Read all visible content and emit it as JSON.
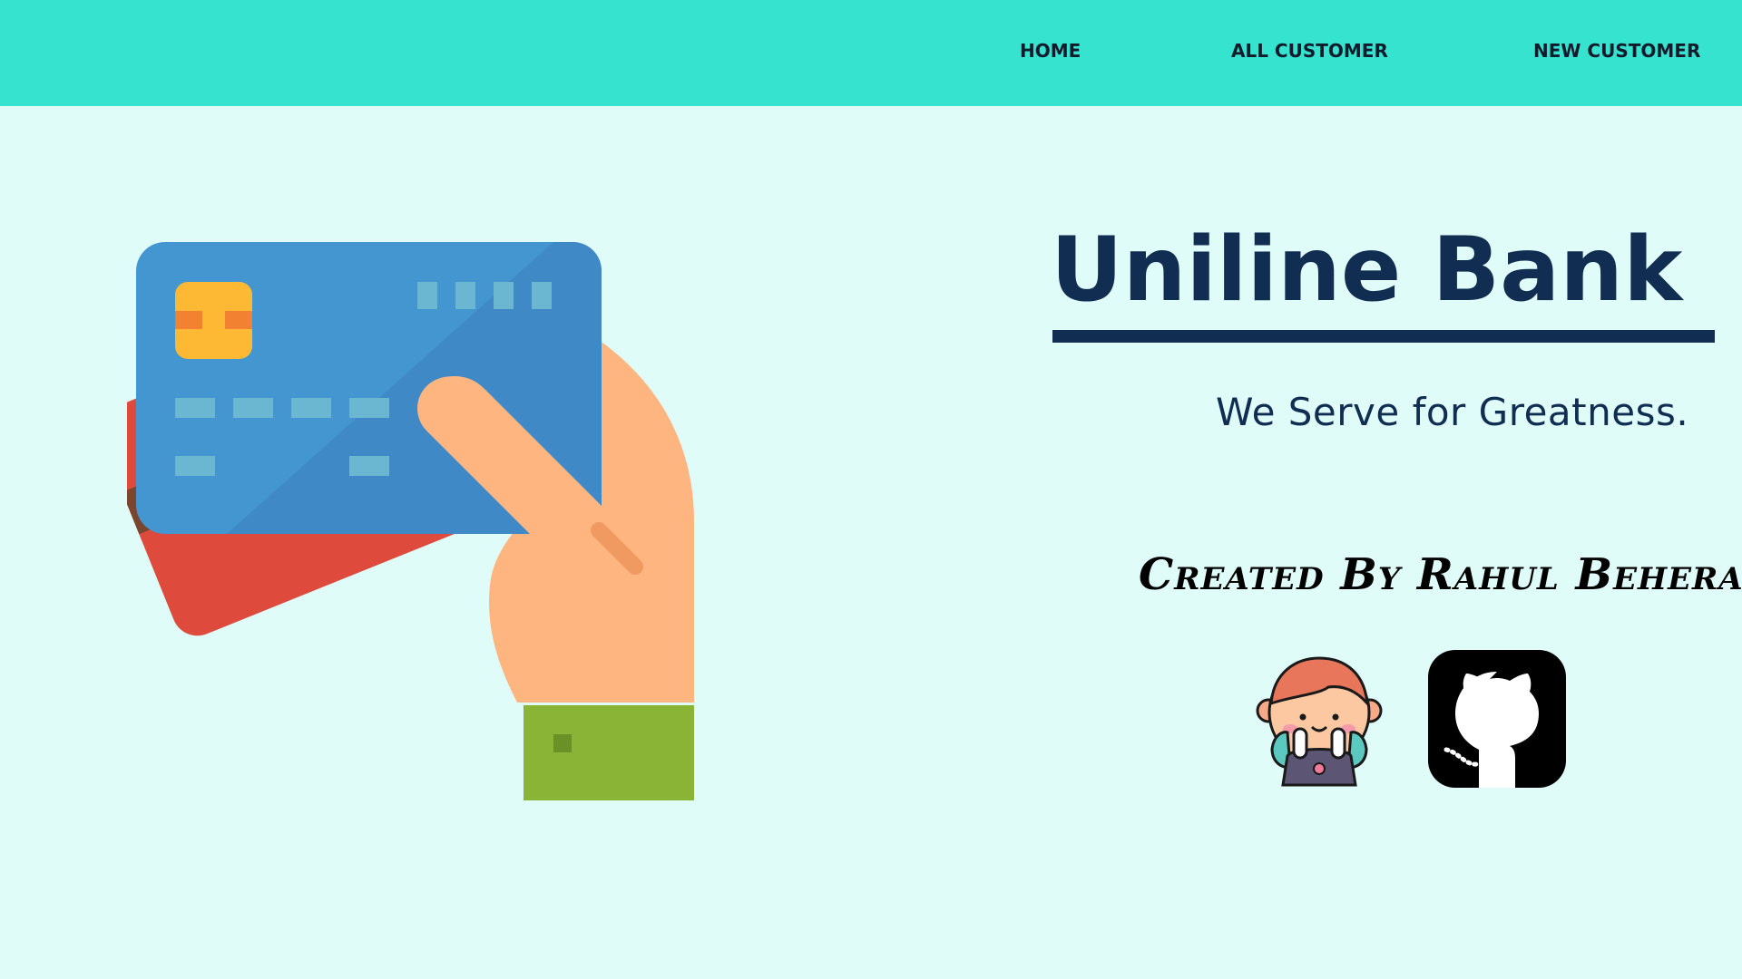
{
  "nav": {
    "home": "HOME",
    "all_customer": "ALL CUSTOMER",
    "new_customer": "NEW CUSTOMER"
  },
  "hero": {
    "title": "Uniline Bank",
    "tagline": "We Serve for Greatness.",
    "creator": "Created By Rahul Behera"
  },
  "icons": {
    "illustration": "hand-holding-credit-cards-icon",
    "avatar": "avatar-icon",
    "github": "github-icon"
  },
  "colors": {
    "navbar": "#35e3cf",
    "background": "#dffcf9",
    "title": "#112d52"
  }
}
